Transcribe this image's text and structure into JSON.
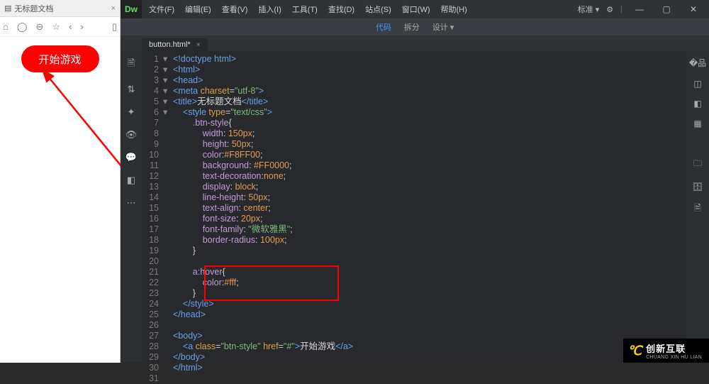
{
  "preview": {
    "tab_title": "无标题文档",
    "button_label": "开始游戏"
  },
  "menubar": {
    "logo": "Dw",
    "items": [
      "文件(F)",
      "编辑(E)",
      "查看(V)",
      "插入(I)",
      "工具(T)",
      "查找(D)",
      "站点(S)",
      "窗口(W)",
      "帮助(H)"
    ],
    "workspace": "标准"
  },
  "viewbar": {
    "items": [
      "代码",
      "拆分",
      "设计"
    ],
    "active_index": 0
  },
  "filetab": {
    "name": "button.html*"
  },
  "code": {
    "lines": [
      {
        "n": 1,
        "fold": "",
        "html": "<span class='tag'>&lt;!doctype html&gt;</span>"
      },
      {
        "n": 2,
        "fold": "▾",
        "html": "<span class='tag'>&lt;html&gt;</span>"
      },
      {
        "n": 3,
        "fold": "▾",
        "html": "<span class='tag'>&lt;head&gt;</span>"
      },
      {
        "n": 4,
        "fold": "",
        "html": "<span class='tag'>&lt;meta</span> <span class='attr'>charset</span>=<span class='str'>\"utf-8\"</span><span class='tag'>&gt;</span>"
      },
      {
        "n": 5,
        "fold": "",
        "html": "<span class='tag'>&lt;title&gt;</span><span class='txt'>无标题文档</span><span class='tag'>&lt;/title&gt;</span>"
      },
      {
        "n": 6,
        "fold": "▾",
        "html": "    <span class='tag'>&lt;style</span> <span class='attr'>type</span>=<span class='str'>\"text/css\"</span><span class='tag'>&gt;</span>"
      },
      {
        "n": 7,
        "fold": "▾",
        "html": "        <span class='sel'>.btn-style</span>{"
      },
      {
        "n": 8,
        "fold": "",
        "html": "            <span class='prop'>width</span>: <span class='num'>150px</span>;"
      },
      {
        "n": 9,
        "fold": "",
        "html": "            <span class='prop'>height</span>: <span class='num'>50px</span>;"
      },
      {
        "n": 10,
        "fold": "",
        "html": "            <span class='prop'>color</span>:<span class='val'>#F8FF00</span>;"
      },
      {
        "n": 11,
        "fold": "",
        "html": "            <span class='prop'>background</span>: <span class='val'>#FF0000</span>;"
      },
      {
        "n": 12,
        "fold": "",
        "html": "            <span class='prop'>text-decoration</span>:<span class='val'>none</span>;"
      },
      {
        "n": 13,
        "fold": "",
        "html": "            <span class='prop'>display</span>: <span class='val'>block</span>;"
      },
      {
        "n": 14,
        "fold": "",
        "html": "            <span class='prop'>line-height</span>: <span class='num'>50px</span>;"
      },
      {
        "n": 15,
        "fold": "",
        "html": "            <span class='prop'>text-align</span>: <span class='val'>center</span>;"
      },
      {
        "n": 16,
        "fold": "",
        "html": "            <span class='prop'>font-size</span>: <span class='num'>20px</span>;"
      },
      {
        "n": 17,
        "fold": "",
        "html": "            <span class='prop'>font-family</span>: <span class='str'>\"微软雅黑\"</span>;"
      },
      {
        "n": 18,
        "fold": "",
        "html": "            <span class='prop'>border-radius</span>: <span class='num'>100px</span>;"
      },
      {
        "n": 19,
        "fold": "",
        "html": "        }"
      },
      {
        "n": 20,
        "fold": "",
        "html": ""
      },
      {
        "n": 21,
        "fold": "▾",
        "html": "        <span class='sel'>a:hover</span>{"
      },
      {
        "n": 22,
        "fold": "",
        "html": "            <span class='prop'>color</span>:<span class='val'>#fff</span>;"
      },
      {
        "n": 23,
        "fold": "",
        "html": "        }"
      },
      {
        "n": 24,
        "fold": "",
        "html": "    <span class='tag'>&lt;/style&gt;</span>"
      },
      {
        "n": 25,
        "fold": "",
        "html": "<span class='tag'>&lt;/head&gt;</span>"
      },
      {
        "n": 26,
        "fold": "",
        "html": ""
      },
      {
        "n": 27,
        "fold": "▾",
        "html": "<span class='tag'>&lt;body&gt;</span>"
      },
      {
        "n": 28,
        "fold": "",
        "html": "    <span class='tag'>&lt;a</span> <span class='attr'>class</span>=<span class='str'>\"btn-style\"</span> <span class='attr'>href</span>=<span class='str'>\"#\"</span><span class='tag'>&gt;</span><span class='txt'>开始游戏</span><span class='tag'>&lt;/a&gt;</span>"
      },
      {
        "n": 29,
        "fold": "",
        "html": "<span class='tag'>&lt;/body&gt;</span>"
      },
      {
        "n": 30,
        "fold": "",
        "html": "<span class='tag'>&lt;/html&gt;</span>"
      },
      {
        "n": 31,
        "fold": "",
        "html": ""
      }
    ]
  },
  "watermark": {
    "cn": "创新互联",
    "py": "CHUANG XIN HU LIAN"
  }
}
